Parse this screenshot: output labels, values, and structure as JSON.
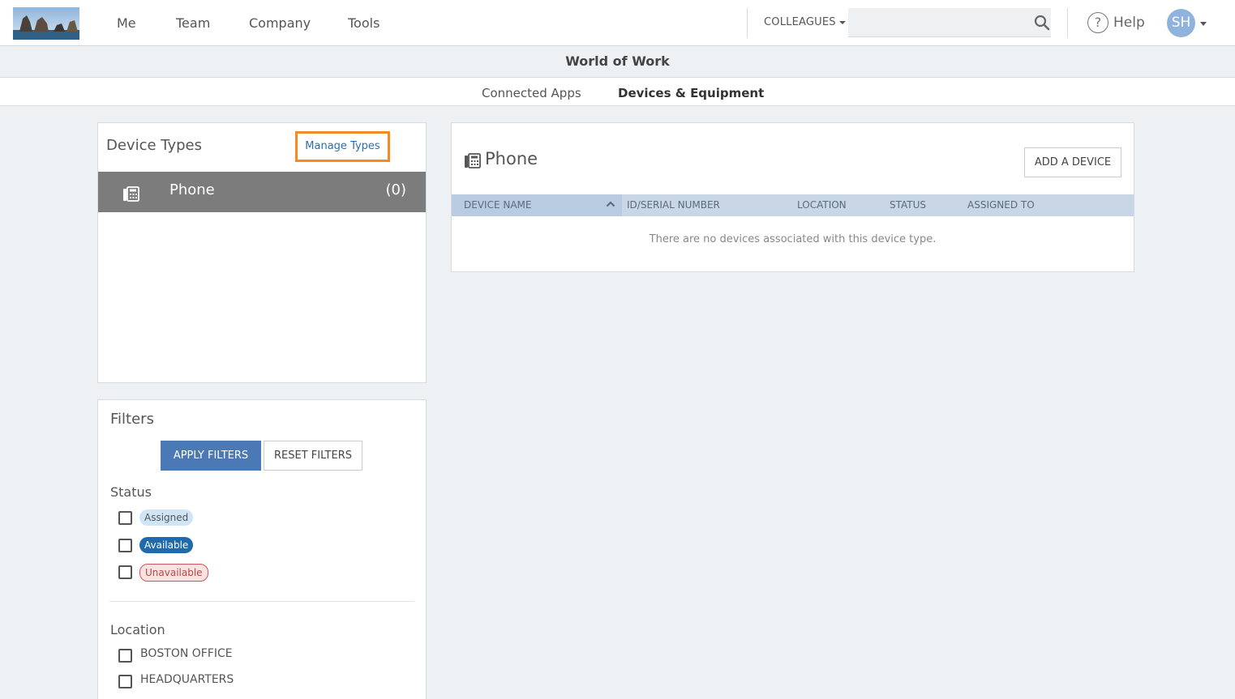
{
  "nav": {
    "links": [
      "Me",
      "Team",
      "Company",
      "Tools"
    ],
    "colleagues_label": "COLLEAGUES",
    "search_placeholder": "",
    "help_label": "Help",
    "avatar_initials": "SH"
  },
  "page": {
    "title": "World of Work",
    "tabs": [
      {
        "label": "Connected Apps",
        "active": false
      },
      {
        "label": "Devices & Equipment",
        "active": true
      }
    ]
  },
  "device_types": {
    "heading": "Device Types",
    "manage_label": "Manage Types",
    "items": [
      {
        "name": "Phone",
        "count": "(0)",
        "icon": "phone-icon"
      }
    ]
  },
  "filters": {
    "heading": "Filters",
    "apply_label": "APPLY FILTERS",
    "reset_label": "RESET FILTERS",
    "status_label": "Status",
    "statuses": [
      "Assigned",
      "Available",
      "Unavailable"
    ],
    "location_label": "Location",
    "locations": [
      "BOSTON OFFICE",
      "HEADQUARTERS"
    ]
  },
  "device_list": {
    "title": "Phone",
    "add_label": "ADD A DEVICE",
    "columns": [
      "DEVICE NAME",
      "ID/SERIAL NUMBER",
      "LOCATION",
      "STATUS",
      "ASSIGNED TO"
    ],
    "empty_message": "There are no devices associated with this device type."
  },
  "colors": {
    "accent": "#4a79b5",
    "highlight": "#f58a1f",
    "selected_row": "#7c7c7c"
  }
}
